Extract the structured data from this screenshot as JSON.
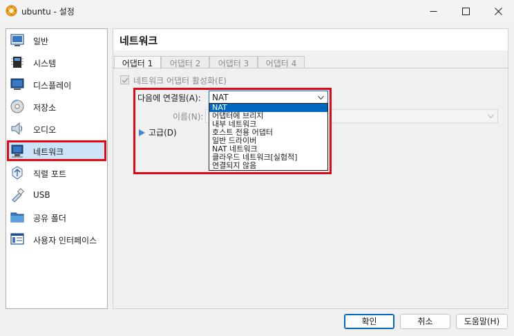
{
  "window": {
    "title": "ubuntu - 설정",
    "minimize_icon": "minimize-icon",
    "maximize_icon": "maximize-icon",
    "close_icon": "close-icon"
  },
  "sidebar": {
    "items": [
      {
        "label": "일반",
        "icon": "general-icon"
      },
      {
        "label": "시스템",
        "icon": "system-icon"
      },
      {
        "label": "디스플레이",
        "icon": "display-icon"
      },
      {
        "label": "저장소",
        "icon": "storage-icon"
      },
      {
        "label": "오디오",
        "icon": "audio-icon"
      },
      {
        "label": "네트워크",
        "icon": "network-icon"
      },
      {
        "label": "직렬 포트",
        "icon": "serial-port-icon"
      },
      {
        "label": "USB",
        "icon": "usb-icon"
      },
      {
        "label": "공유 폴더",
        "icon": "shared-folder-icon"
      },
      {
        "label": "사용자 인터페이스",
        "icon": "user-interface-icon"
      }
    ],
    "selected": "네트워크"
  },
  "main": {
    "title": "네트워크",
    "tabs": [
      {
        "label": "어댑터 1"
      },
      {
        "label": "어댑터 2"
      },
      {
        "label": "어댑터 3"
      },
      {
        "label": "어댑터 4"
      }
    ],
    "enable_checkbox_label": "네트워크 어댑터 활성화(E)",
    "attached_label": "다음에 연결됨(A):",
    "attached_value": "NAT",
    "name_label": "이름(N):",
    "advanced_label": "고급(D)",
    "dropdown_options": [
      "NAT",
      "어댑터에 브리지",
      "내부 네트워크",
      "호스트 전용 어댑터",
      "일반 드라이버",
      "NAT 네트워크",
      "클라우드 네트워크[실험적]",
      "연결되지 않음"
    ]
  },
  "buttons": {
    "ok": "확인",
    "cancel": "취소",
    "help": "도움말(H)"
  },
  "colors": {
    "accent": "#0067c0",
    "highlight": "#e30613",
    "selection": "#cce4f7"
  }
}
